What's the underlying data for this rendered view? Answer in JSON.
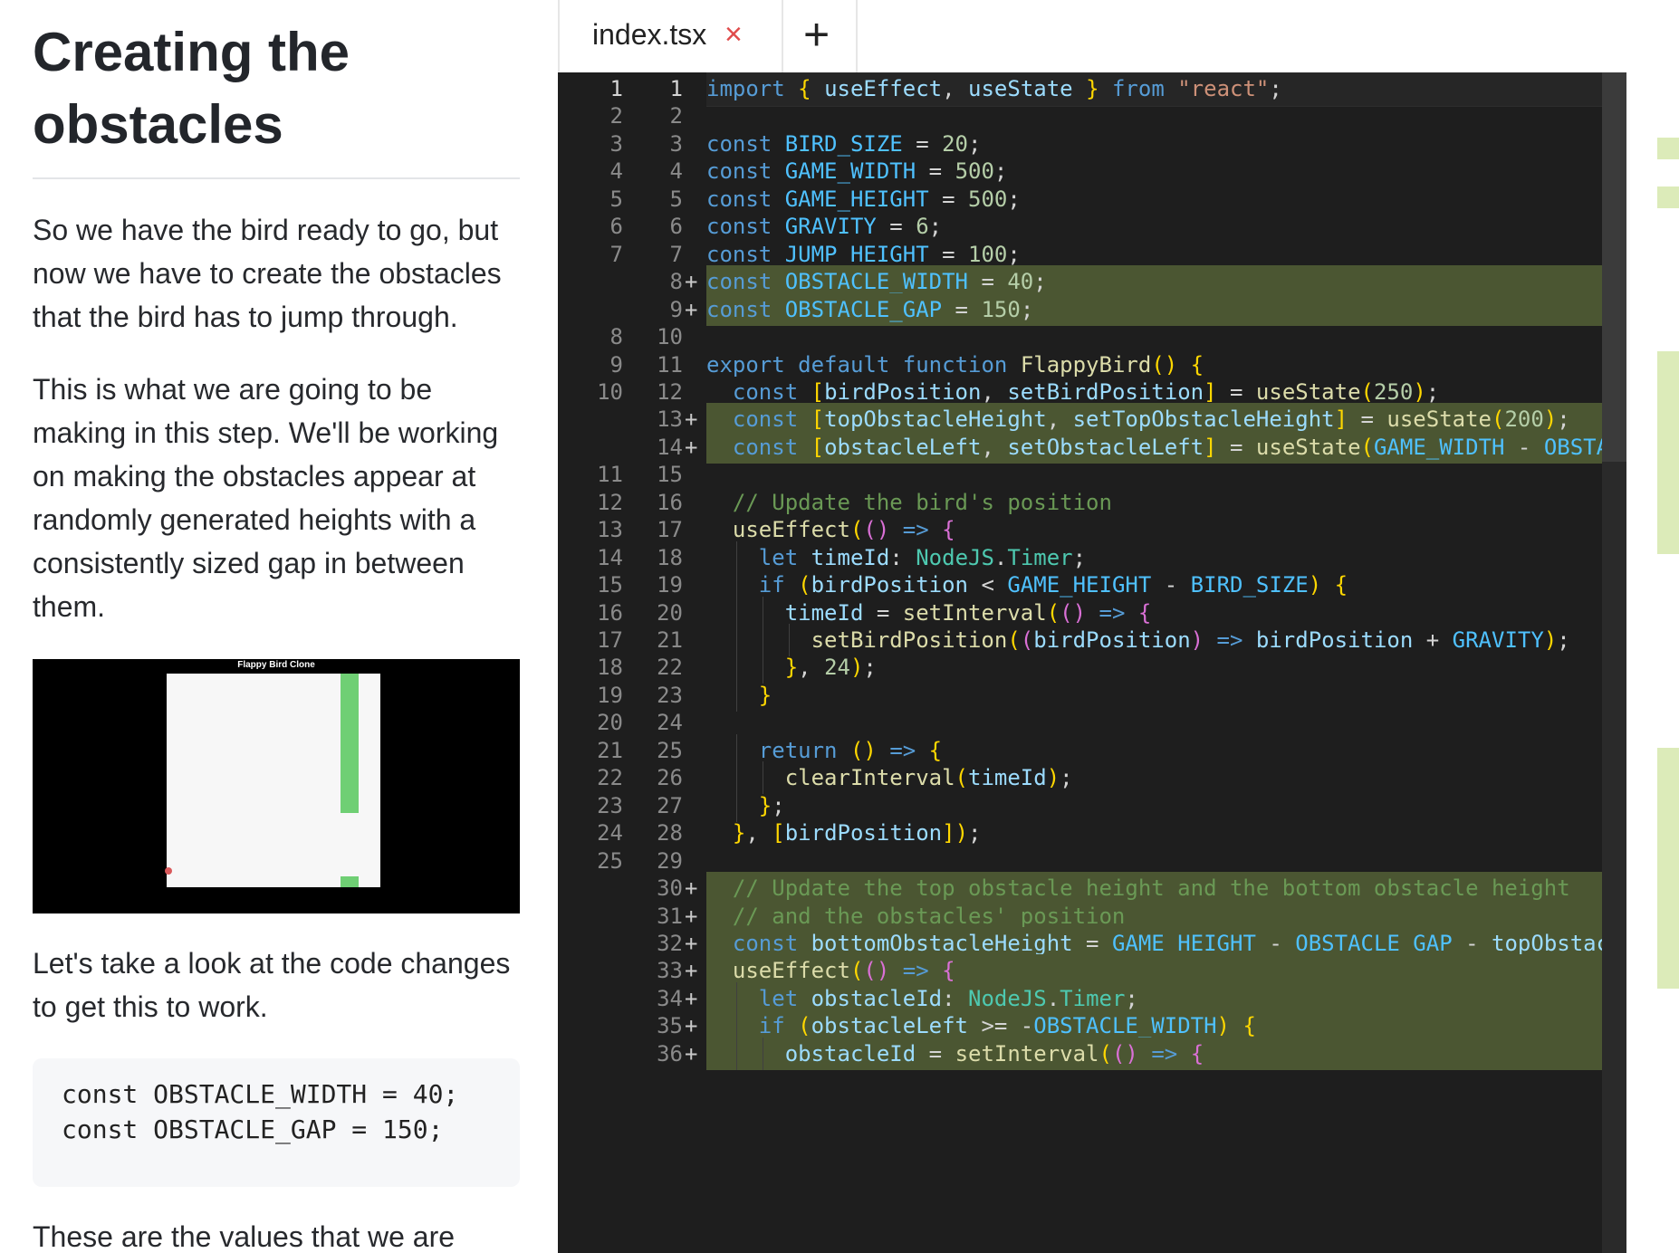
{
  "article": {
    "title": "Creating the obstacles",
    "para1": "So we have the bird ready to go, but now we have to create the obstacles that the bird has to jump through.",
    "para2": "This is what we are going to be making in this step. We'll be working on making the obstacles appear at randomly generated heights with a consistently sized gap in between them.",
    "preview_title": "Flappy Bird Clone",
    "para3": "Let's take a look at the code changes to get this to work.",
    "snippet_line1": "const OBSTACLE_WIDTH = 40;",
    "snippet_line2": "const OBSTACLE_GAP = 150;",
    "para4": "These are the values that we are"
  },
  "editor": {
    "tab_name": "index.tsx",
    "close_glyph": "×",
    "add_glyph": "+",
    "lines": [
      {
        "old": "1",
        "new": "1",
        "add": false,
        "cur": true
      },
      {
        "old": "2",
        "new": "2",
        "add": false
      },
      {
        "old": "3",
        "new": "3",
        "add": false
      },
      {
        "old": "4",
        "new": "4",
        "add": false
      },
      {
        "old": "5",
        "new": "5",
        "add": false
      },
      {
        "old": "6",
        "new": "6",
        "add": false
      },
      {
        "old": "7",
        "new": "7",
        "add": false
      },
      {
        "old": "",
        "new": "8",
        "add": true
      },
      {
        "old": "",
        "new": "9",
        "add": true
      },
      {
        "old": "8",
        "new": "10",
        "add": false
      },
      {
        "old": "9",
        "new": "11",
        "add": false
      },
      {
        "old": "10",
        "new": "12",
        "add": false
      },
      {
        "old": "",
        "new": "13",
        "add": true
      },
      {
        "old": "",
        "new": "14",
        "add": true
      },
      {
        "old": "11",
        "new": "15",
        "add": false
      },
      {
        "old": "12",
        "new": "16",
        "add": false
      },
      {
        "old": "13",
        "new": "17",
        "add": false
      },
      {
        "old": "14",
        "new": "18",
        "add": false
      },
      {
        "old": "15",
        "new": "19",
        "add": false
      },
      {
        "old": "16",
        "new": "20",
        "add": false
      },
      {
        "old": "17",
        "new": "21",
        "add": false
      },
      {
        "old": "18",
        "new": "22",
        "add": false
      },
      {
        "old": "19",
        "new": "23",
        "add": false
      },
      {
        "old": "20",
        "new": "24",
        "add": false
      },
      {
        "old": "21",
        "new": "25",
        "add": false
      },
      {
        "old": "22",
        "new": "26",
        "add": false
      },
      {
        "old": "23",
        "new": "27",
        "add": false
      },
      {
        "old": "24",
        "new": "28",
        "add": false
      },
      {
        "old": "25",
        "new": "29",
        "add": false
      },
      {
        "old": "",
        "new": "30",
        "add": true
      },
      {
        "old": "",
        "new": "31",
        "add": true
      },
      {
        "old": "",
        "new": "32",
        "add": true
      },
      {
        "old": "",
        "new": "33",
        "add": true
      },
      {
        "old": "",
        "new": "34",
        "add": true
      },
      {
        "old": "",
        "new": "35",
        "add": true
      },
      {
        "old": "",
        "new": "36",
        "add": true
      }
    ],
    "code": [
      "import { useEffect, useState } from \"react\";",
      "",
      "const BIRD_SIZE = 20;",
      "const GAME_WIDTH = 500;",
      "const GAME_HEIGHT = 500;",
      "const GRAVITY = 6;",
      "const JUMP_HEIGHT = 100;",
      "const OBSTACLE_WIDTH = 40;",
      "const OBSTACLE_GAP = 150;",
      "",
      "export default function FlappyBird() {",
      "  const [birdPosition, setBirdPosition] = useState(250);",
      "  const [topObstacleHeight, setTopObstacleHeight] = useState(200);",
      "  const [obstacleLeft, setObstacleLeft] = useState(GAME_WIDTH - OBSTACLE_WIDTH);",
      "",
      "  // Update the bird's position",
      "  useEffect(() => {",
      "    let timeId: NodeJS.Timer;",
      "    if (birdPosition < GAME_HEIGHT - BIRD_SIZE) {",
      "      timeId = setInterval(() => {",
      "        setBirdPosition((birdPosition) => birdPosition + GRAVITY);",
      "      }, 24);",
      "    }",
      "",
      "    return () => {",
      "      clearInterval(timeId);",
      "    };",
      "  }, [birdPosition]);",
      "",
      "  // Update the top obstacle height and the bottom obstacle height",
      "  // and the obstacles' position",
      "  const bottomObstacleHeight = GAME_HEIGHT - OBSTACLE_GAP - topObstacleHeight;",
      "  useEffect(() => {",
      "    let obstacleId: NodeJS.Timer;",
      "    if (obstacleLeft >= -OBSTACLE_WIDTH) {",
      "      obstacleId = setInterval(() => {"
    ]
  }
}
